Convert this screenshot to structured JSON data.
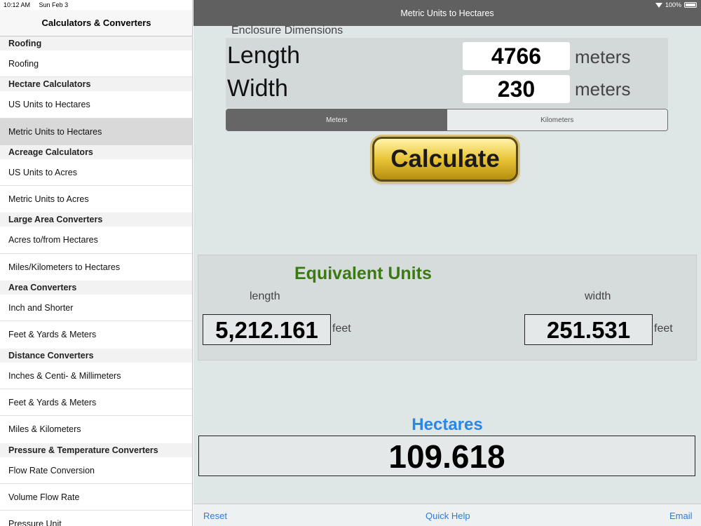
{
  "status": {
    "time": "10:12 AM",
    "date": "Sun Feb 3",
    "battery": "100%"
  },
  "sidebar": {
    "title": "Calculators & Converters",
    "sections": [
      {
        "header": "Roofing",
        "items": [
          "Roofing"
        ]
      },
      {
        "header": "Hectare Calculators",
        "items": [
          "US Units to Hectares",
          "Metric Units to Hectares"
        ]
      },
      {
        "header": "Acreage Calculators",
        "items": [
          "US Units to Acres",
          "Metric Units to Acres"
        ]
      },
      {
        "header": "Large Area Converters",
        "items": [
          "Acres to/from Hectares",
          "Miles/Kilometers to Hectares"
        ]
      },
      {
        "header": "Area Converters",
        "items": [
          "Inch and Shorter",
          "Feet & Yards & Meters"
        ]
      },
      {
        "header": "Distance Converters",
        "items": [
          "Inches & Centi- & Millimeters",
          "Feet & Yards & Meters",
          "Miles & Kilometers"
        ]
      },
      {
        "header": "Pressure & Temperature Converters",
        "items": [
          "Flow Rate Conversion",
          "Volume Flow Rate",
          "Pressure Unit"
        ]
      }
    ],
    "selected": "Metric Units to Hectares"
  },
  "nav": {
    "title": "Metric Units to Hectares"
  },
  "enclosure": {
    "label": "Enclosure Dimensions",
    "length_label": "Length",
    "length_value": "4766",
    "width_label": "Width",
    "width_value": "230",
    "unit": "meters"
  },
  "segmented": {
    "options": [
      "Meters",
      "Kilometers"
    ],
    "selected": "Meters"
  },
  "calculate_label": "Calculate",
  "equivalent": {
    "title": "Equivalent Units",
    "length_label": "length",
    "length_value": "5,212.161",
    "width_label": "width",
    "width_value": "251.531",
    "unit": "feet"
  },
  "result": {
    "label": "Hectares",
    "value": "109.618"
  },
  "toolbar": {
    "reset": "Reset",
    "quick_help": "Quick Help",
    "email": "Email"
  },
  "colors": {
    "nav_bar": "#606060",
    "equiv_title": "#3b7a12",
    "hectares_label": "#2a86e8",
    "link": "#2a7adf"
  }
}
